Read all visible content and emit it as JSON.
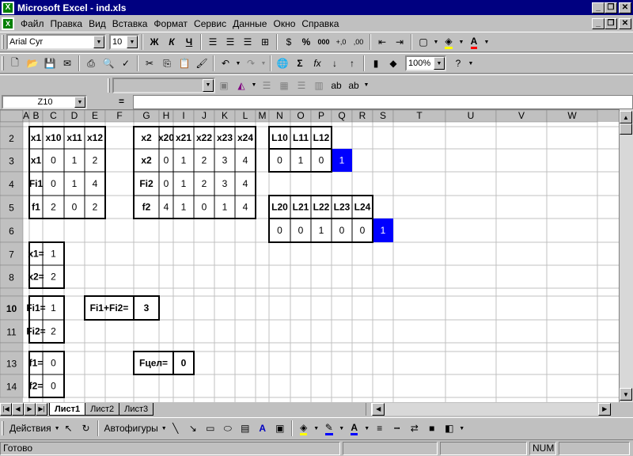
{
  "window": {
    "title": "Microsoft Excel - ind.xls",
    "app_icon": "excel-icon"
  },
  "menu": [
    "Файл",
    "Правка",
    "Вид",
    "Вставка",
    "Формат",
    "Сервис",
    "Данные",
    "Окно",
    "Справка"
  ],
  "format_toolbar": {
    "font_name": "Arial Cyr",
    "font_size": "10",
    "bold": "Ж",
    "italic": "К",
    "underline": "Ч",
    "percent": "%",
    "thousands": "000",
    "dec_inc": "+,0",
    "dec_dec": ",00"
  },
  "standard_toolbar": {
    "zoom": "100%",
    "sum": "Σ",
    "fx": "fx"
  },
  "formula_bar": {
    "name_box": "Z10",
    "equals": "=",
    "formula": ""
  },
  "columns": [
    "A",
    "B",
    "C",
    "D",
    "E",
    "F",
    "G",
    "H",
    "I",
    "J",
    "K",
    "L",
    "M",
    "N",
    "O",
    "P",
    "Q",
    "R",
    "S",
    "T",
    "U",
    "V",
    "W"
  ],
  "rows": [
    "1",
    "2",
    "3",
    "4",
    "5",
    "6",
    "7",
    "8",
    "9",
    "10",
    "11",
    "12",
    "13",
    "14"
  ],
  "cells": [
    {
      "r": 1,
      "c": 1,
      "v": "x1",
      "b": true
    },
    {
      "r": 1,
      "c": 2,
      "v": "x10",
      "b": true
    },
    {
      "r": 1,
      "c": 3,
      "v": "x11",
      "b": true
    },
    {
      "r": 1,
      "c": 4,
      "v": "x12",
      "b": true
    },
    {
      "r": 2,
      "c": 1,
      "v": "x1",
      "b": true
    },
    {
      "r": 2,
      "c": 2,
      "v": "0"
    },
    {
      "r": 2,
      "c": 3,
      "v": "1"
    },
    {
      "r": 2,
      "c": 4,
      "v": "2"
    },
    {
      "r": 3,
      "c": 1,
      "v": "Fi1",
      "b": true
    },
    {
      "r": 3,
      "c": 2,
      "v": "0"
    },
    {
      "r": 3,
      "c": 3,
      "v": "1"
    },
    {
      "r": 3,
      "c": 4,
      "v": "4"
    },
    {
      "r": 4,
      "c": 1,
      "v": "f1",
      "b": true
    },
    {
      "r": 4,
      "c": 2,
      "v": "2"
    },
    {
      "r": 4,
      "c": 3,
      "v": "0"
    },
    {
      "r": 4,
      "c": 4,
      "v": "2"
    },
    {
      "r": 1,
      "c": 6,
      "v": "x2",
      "b": true
    },
    {
      "r": 1,
      "c": 7,
      "v": "x20",
      "b": true
    },
    {
      "r": 1,
      "c": 8,
      "v": "x21",
      "b": true
    },
    {
      "r": 1,
      "c": 9,
      "v": "x22",
      "b": true
    },
    {
      "r": 1,
      "c": 10,
      "v": "x23",
      "b": true
    },
    {
      "r": 1,
      "c": 11,
      "v": "x24",
      "b": true
    },
    {
      "r": 2,
      "c": 6,
      "v": "x2",
      "b": true
    },
    {
      "r": 2,
      "c": 7,
      "v": "0"
    },
    {
      "r": 2,
      "c": 8,
      "v": "1"
    },
    {
      "r": 2,
      "c": 9,
      "v": "2"
    },
    {
      "r": 2,
      "c": 10,
      "v": "3"
    },
    {
      "r": 2,
      "c": 11,
      "v": "4"
    },
    {
      "r": 3,
      "c": 6,
      "v": "Fi2",
      "b": true
    },
    {
      "r": 3,
      "c": 7,
      "v": "0"
    },
    {
      "r": 3,
      "c": 8,
      "v": "1"
    },
    {
      "r": 3,
      "c": 9,
      "v": "2"
    },
    {
      "r": 3,
      "c": 10,
      "v": "3"
    },
    {
      "r": 3,
      "c": 11,
      "v": "4"
    },
    {
      "r": 4,
      "c": 6,
      "v": "f2",
      "b": true
    },
    {
      "r": 4,
      "c": 7,
      "v": "4"
    },
    {
      "r": 4,
      "c": 8,
      "v": "1"
    },
    {
      "r": 4,
      "c": 9,
      "v": "0"
    },
    {
      "r": 4,
      "c": 10,
      "v": "1"
    },
    {
      "r": 4,
      "c": 11,
      "v": "4"
    },
    {
      "r": 1,
      "c": 13,
      "v": "L10",
      "b": true
    },
    {
      "r": 1,
      "c": 14,
      "v": "L11",
      "b": true
    },
    {
      "r": 1,
      "c": 15,
      "v": "L12",
      "b": true
    },
    {
      "r": 2,
      "c": 13,
      "v": "0"
    },
    {
      "r": 2,
      "c": 14,
      "v": "1"
    },
    {
      "r": 2,
      "c": 15,
      "v": "0"
    },
    {
      "r": 2,
      "c": 16,
      "v": "1",
      "hl": true
    },
    {
      "r": 4,
      "c": 13,
      "v": "L20",
      "b": true
    },
    {
      "r": 4,
      "c": 14,
      "v": "L21",
      "b": true
    },
    {
      "r": 4,
      "c": 15,
      "v": "L22",
      "b": true
    },
    {
      "r": 4,
      "c": 16,
      "v": "L23",
      "b": true
    },
    {
      "r": 4,
      "c": 17,
      "v": "L24",
      "b": true
    },
    {
      "r": 5,
      "c": 13,
      "v": "0"
    },
    {
      "r": 5,
      "c": 14,
      "v": "0"
    },
    {
      "r": 5,
      "c": 15,
      "v": "1"
    },
    {
      "r": 5,
      "c": 16,
      "v": "0"
    },
    {
      "r": 5,
      "c": 17,
      "v": "0"
    },
    {
      "r": 5,
      "c": 18,
      "v": "1",
      "hl": true
    },
    {
      "r": 6,
      "c": 1,
      "v": "x1=",
      "b": true
    },
    {
      "r": 6,
      "c": 2,
      "v": "1"
    },
    {
      "r": 7,
      "c": 1,
      "v": "x2=",
      "b": true
    },
    {
      "r": 7,
      "c": 2,
      "v": "2"
    },
    {
      "r": 9,
      "c": 1,
      "v": "Fi1=",
      "b": true
    },
    {
      "r": 9,
      "c": 2,
      "v": "1"
    },
    {
      "r": 10,
      "c": 1,
      "v": "Fi2=",
      "b": true
    },
    {
      "r": 10,
      "c": 2,
      "v": "2"
    },
    {
      "r": 9,
      "c": 4,
      "v": "Fi1+Fi2=",
      "b": true,
      "span": 2
    },
    {
      "r": 9,
      "c": 6,
      "v": "3",
      "b": true
    },
    {
      "r": 12,
      "c": 1,
      "v": "f1=",
      "b": true
    },
    {
      "r": 12,
      "c": 2,
      "v": "0"
    },
    {
      "r": 13,
      "c": 1,
      "v": "f2=",
      "b": true
    },
    {
      "r": 13,
      "c": 2,
      "v": "0"
    },
    {
      "r": 12,
      "c": 6,
      "v": "Fцел=",
      "b": true,
      "span": 2
    },
    {
      "r": 12,
      "c": 8,
      "v": "0",
      "b": true
    }
  ],
  "sheet_tabs": [
    "Лист1",
    "Лист2",
    "Лист3"
  ],
  "active_sheet": "Лист1",
  "drawing_toolbar": {
    "actions": "Действия",
    "autoshapes": "Автофигуры"
  },
  "status": {
    "ready": "Готово",
    "num": "NUM"
  },
  "colors": {
    "titlebar": "#000080",
    "highlight": "#0000ff",
    "grid_line": "#c0c0c0",
    "background": "#c0c0c0"
  }
}
